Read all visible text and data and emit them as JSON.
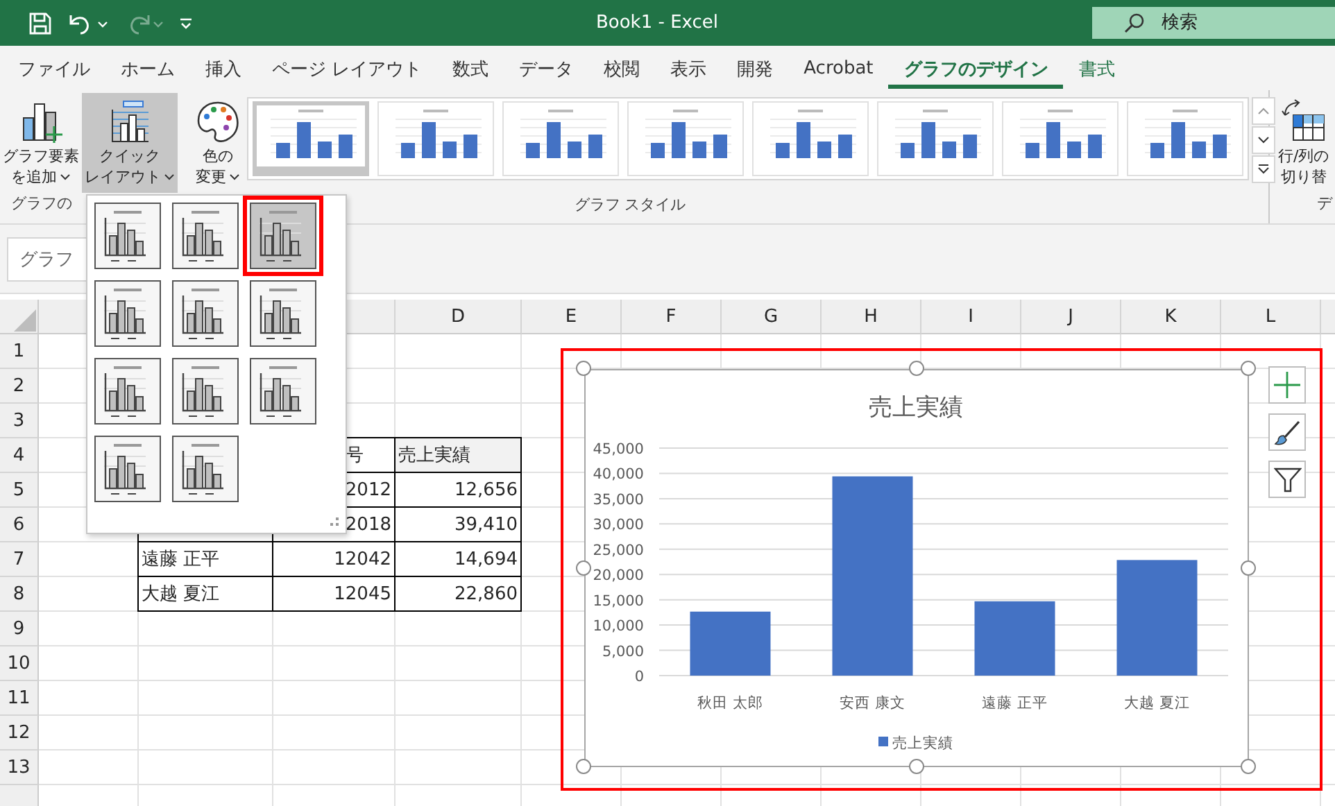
{
  "title_bar": {
    "title": "Book1 - Excel",
    "quick_access": [
      {
        "kind": "save",
        "disabled": false
      },
      {
        "kind": "undo",
        "disabled": false
      },
      {
        "kind": "redo",
        "disabled": true
      },
      {
        "kind": "customize",
        "disabled": false
      }
    ],
    "search": {
      "placeholder": "検索"
    }
  },
  "tabs": [
    {
      "label": "ファイル",
      "selected": false,
      "contextual": false
    },
    {
      "label": "ホーム",
      "selected": false,
      "contextual": false
    },
    {
      "label": "挿入",
      "selected": false,
      "contextual": false
    },
    {
      "label": "ページ レイアウト",
      "selected": false,
      "contextual": false
    },
    {
      "label": "数式",
      "selected": false,
      "contextual": false
    },
    {
      "label": "データ",
      "selected": false,
      "contextual": false
    },
    {
      "label": "校閲",
      "selected": false,
      "contextual": false
    },
    {
      "label": "表示",
      "selected": false,
      "contextual": false
    },
    {
      "label": "開発",
      "selected": false,
      "contextual": false
    },
    {
      "label": "Acrobat",
      "selected": false,
      "contextual": false
    },
    {
      "label": "グラフのデザイン",
      "selected": true,
      "contextual": true
    },
    {
      "label": "書式",
      "selected": false,
      "contextual": true
    }
  ],
  "ribbon": {
    "groups": [
      {
        "label": "グラフの",
        "buttons": [
          {
            "kind": "add-element",
            "lines": [
              "グラフ要素",
              "を追加"
            ],
            "dropdown": true,
            "pressed": false
          },
          {
            "kind": "quick-layout",
            "lines": [
              "クイック",
              "レイアウト"
            ],
            "dropdown": true,
            "pressed": true
          }
        ]
      },
      {
        "label": "グラフ スタイル",
        "buttons": [
          {
            "kind": "color",
            "lines": [
              "色の",
              "変更"
            ],
            "dropdown": true,
            "pressed": false
          }
        ],
        "styles": [
          {
            "selected": true
          },
          {
            "selected": false
          },
          {
            "selected": false
          },
          {
            "selected": false
          },
          {
            "selected": false
          },
          {
            "selected": false
          },
          {
            "selected": false
          },
          {
            "selected": false
          }
        ]
      },
      {
        "label": "デ",
        "buttons": [
          {
            "kind": "switch",
            "lines": [
              "行/列の",
              "切り替"
            ],
            "dropdown": false,
            "pressed": false
          }
        ]
      }
    ]
  },
  "name_box": {
    "value": "グラフ"
  },
  "layout_menu": {
    "items": [
      {
        "selected": false
      },
      {
        "selected": false
      },
      {
        "selected": true
      },
      {
        "selected": false
      },
      {
        "selected": false
      },
      {
        "selected": false
      },
      {
        "selected": false
      },
      {
        "selected": false
      },
      {
        "selected": false
      },
      {
        "selected": false
      },
      {
        "selected": false
      }
    ]
  },
  "sheet": {
    "columns": [
      "D",
      "E",
      "F",
      "G",
      "H",
      "I",
      "J",
      "K",
      "L"
    ],
    "rows": [
      {
        "label": "1"
      },
      {
        "label": "2"
      },
      {
        "label": "3"
      },
      {
        "label": "4",
        "header": true,
        "cells": {
          "c": "号",
          "d": "売上実績"
        }
      },
      {
        "label": "5",
        "header": false,
        "cells": {
          "c": "2012",
          "d": "12,656"
        }
      },
      {
        "label": "6",
        "header": false,
        "cells": {
          "c": "2018",
          "d": "39,410"
        }
      },
      {
        "label": "7",
        "header": false,
        "cells": {
          "b": "遠藤 正平",
          "c": "12042",
          "d": "14,694"
        }
      },
      {
        "label": "8",
        "header": false,
        "cells": {
          "b": "大越 夏江",
          "c": "12045",
          "d": "22,860"
        }
      },
      {
        "label": "9"
      },
      {
        "label": "10"
      },
      {
        "label": "11"
      },
      {
        "label": "12"
      },
      {
        "label": "13"
      }
    ]
  },
  "chart": {
    "chart_data": {
      "type": "bar",
      "title": "売上実績",
      "categories": [
        "秋田 太郎",
        "安西 康文",
        "遠藤 正平",
        "大越 夏江"
      ],
      "grid": true,
      "series": [
        {
          "name": "売上実績",
          "color": "#4472c4",
          "values": [
            12656,
            39410,
            14694,
            22860
          ]
        }
      ],
      "ylim": [
        0,
        45000
      ],
      "yticks": [
        {
          "value": 0,
          "label": "0"
        },
        {
          "value": 5000,
          "label": "5,000"
        },
        {
          "value": 10000,
          "label": "10,000"
        },
        {
          "value": 15000,
          "label": "15,000"
        },
        {
          "value": 20000,
          "label": "20,000"
        },
        {
          "value": 25000,
          "label": "25,000"
        },
        {
          "value": 30000,
          "label": "30,000"
        },
        {
          "value": 35000,
          "label": "35,000"
        },
        {
          "value": 40000,
          "label": "40,000"
        },
        {
          "value": 45000,
          "label": "45,000"
        }
      ]
    }
  }
}
